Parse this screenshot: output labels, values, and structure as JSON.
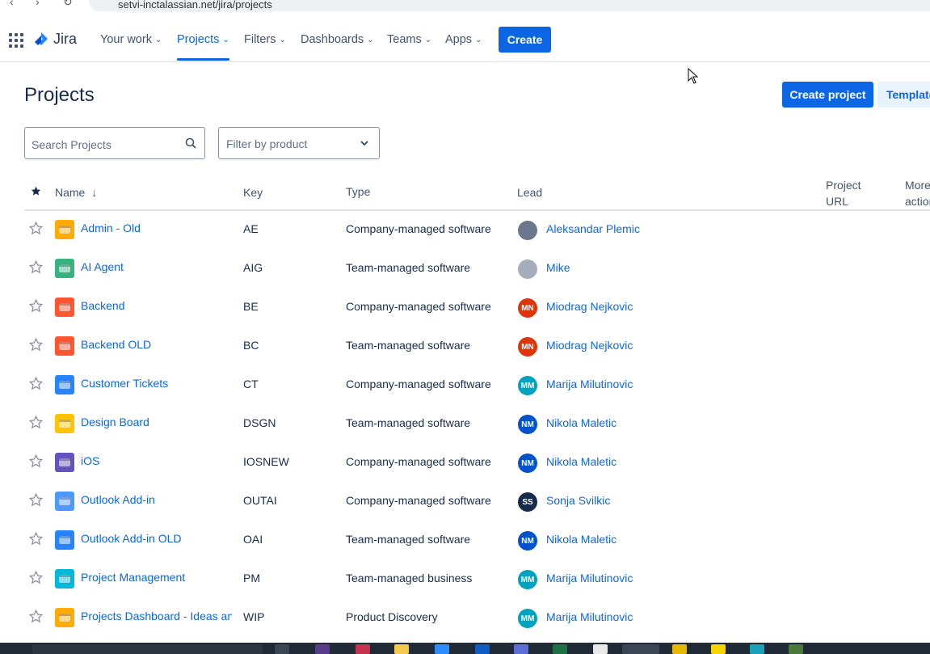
{
  "browser": {
    "url": "setvi-inctalassian.net/jira/projects"
  },
  "nav": {
    "logo_text": "Jira",
    "items": [
      {
        "label": "Your work",
        "active": false
      },
      {
        "label": "Projects",
        "active": true
      },
      {
        "label": "Filters",
        "active": false
      },
      {
        "label": "Dashboards",
        "active": false
      },
      {
        "label": "Teams",
        "active": false
      },
      {
        "label": "Apps",
        "active": false
      }
    ],
    "create_label": "Create"
  },
  "page": {
    "title": "Projects",
    "create_project_label": "Create project",
    "templates_label": "Templates"
  },
  "filters": {
    "search_placeholder": "Search Projects",
    "product_placeholder": "Filter by product"
  },
  "table": {
    "headers": {
      "name": "Name",
      "key": "Key",
      "type": "Type",
      "lead": "Lead",
      "url": "Project URL",
      "actions": "More actions"
    },
    "rows": [
      {
        "name": "Admin - Old",
        "key": "AE",
        "type": "Company-managed software",
        "lead": "Aleksandar Plemic",
        "initials": "",
        "avatar_color": "#6b778c",
        "icon_color": "#ffab00"
      },
      {
        "name": "AI Agent",
        "key": "AIG",
        "type": "Team-managed software",
        "lead": "Mike",
        "initials": "",
        "avatar_color": "#a5adba",
        "icon_color": "#36b37e"
      },
      {
        "name": "Backend",
        "key": "BE",
        "type": "Company-managed software",
        "lead": "Miodrag Nejkovic",
        "initials": "MN",
        "avatar_color": "#de350b",
        "icon_color": "#ff5630"
      },
      {
        "name": "Backend OLD",
        "key": "BC",
        "type": "Team-managed software",
        "lead": "Miodrag Nejkovic",
        "initials": "MN",
        "avatar_color": "#de350b",
        "icon_color": "#ff5630"
      },
      {
        "name": "Customer Tickets",
        "key": "CT",
        "type": "Company-managed software",
        "lead": "Marija Milutinovic",
        "initials": "MM",
        "avatar_color": "#00a3bf",
        "icon_color": "#2684ff"
      },
      {
        "name": "Design Board",
        "key": "DSGN",
        "type": "Team-managed software",
        "lead": "Nikola Maletic",
        "initials": "NM",
        "avatar_color": "#0052cc",
        "icon_color": "#ffc400"
      },
      {
        "name": "iOS",
        "key": "IOSNEW",
        "type": "Company-managed software",
        "lead": "Nikola Maletic",
        "initials": "NM",
        "avatar_color": "#0052cc",
        "icon_color": "#6554c0"
      },
      {
        "name": "Outlook Add-in",
        "key": "OUTAI",
        "type": "Company-managed software",
        "lead": "Sonja Svilkic",
        "initials": "SS",
        "avatar_color": "#172b4d",
        "icon_color": "#4c9aff"
      },
      {
        "name": "Outlook Add-in OLD",
        "key": "OAI",
        "type": "Team-managed software",
        "lead": "Nikola Maletic",
        "initials": "NM",
        "avatar_color": "#0052cc",
        "icon_color": "#2684ff"
      },
      {
        "name": "Project Management",
        "key": "PM",
        "type": "Team-managed business",
        "lead": "Marija Milutinovic",
        "initials": "MM",
        "avatar_color": "#00a3bf",
        "icon_color": "#00b8d9"
      },
      {
        "name": "Projects Dashboard - Ideas an",
        "key": "WIP",
        "type": "Product Discovery",
        "lead": "Marija Milutinovic",
        "initials": "MM",
        "avatar_color": "#00a3bf",
        "icon_color": "#ffab00"
      }
    ]
  },
  "icons": {
    "app_switcher": "grid-icon",
    "search": "search-icon",
    "dropdown": "chevron-down-icon",
    "star": "star-icon",
    "sort": "arrow-down-icon"
  },
  "colors": {
    "brand": "#0c66e4",
    "text": "#172b4d",
    "subtle": "#44546f"
  }
}
